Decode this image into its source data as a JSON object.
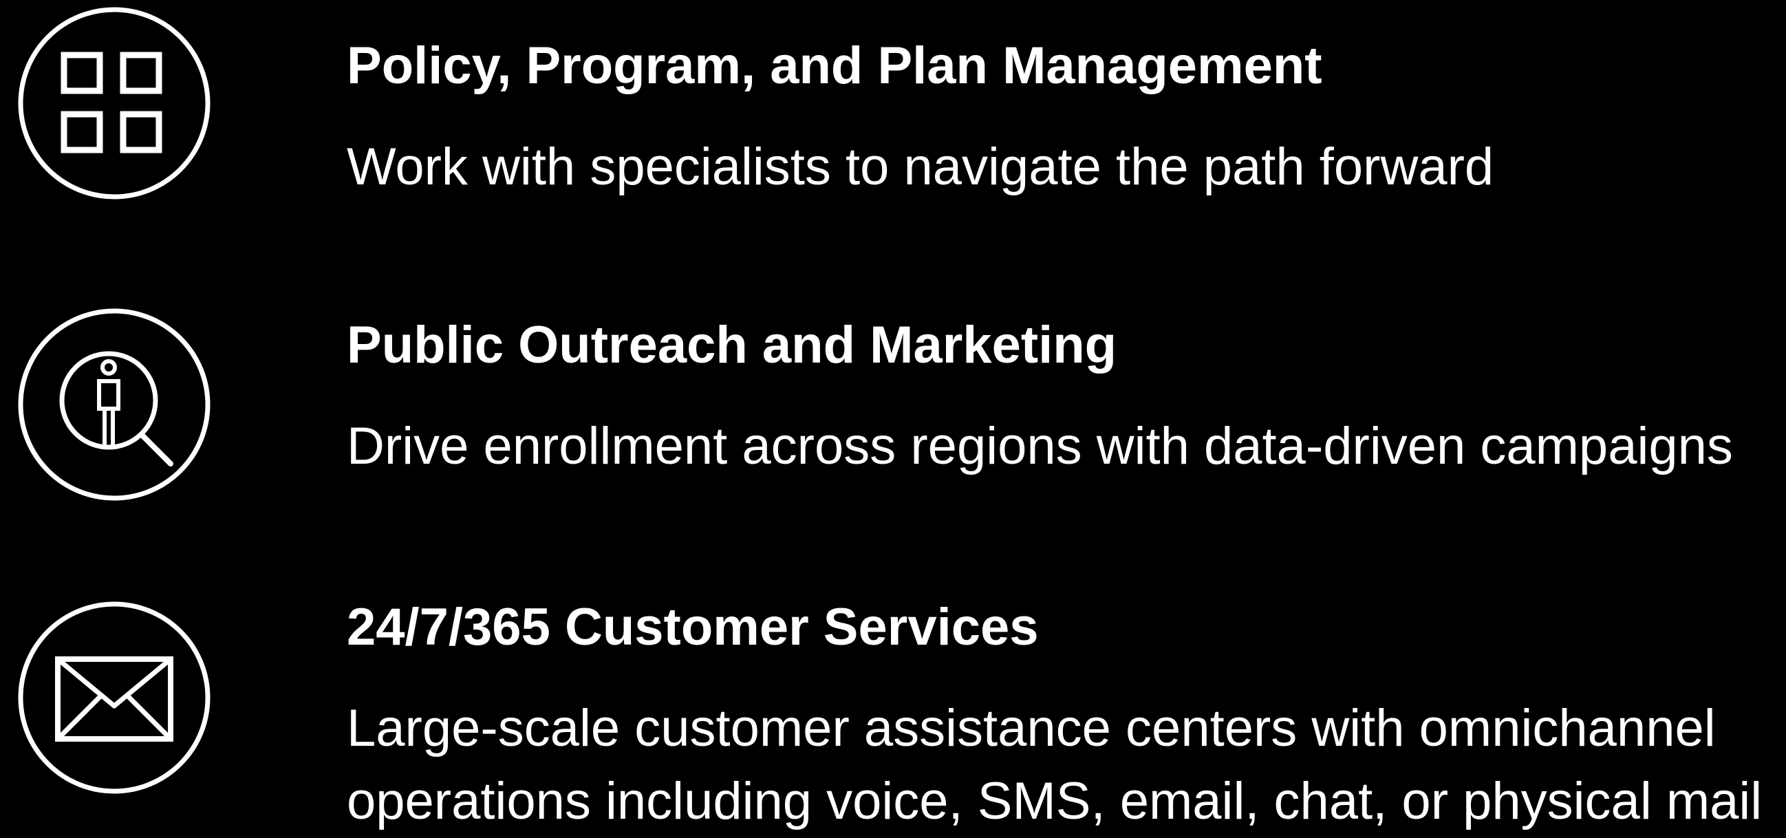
{
  "services": [
    {
      "icon": "grid-icon",
      "title": "Policy, Program, and Plan Management",
      "description": "Work with specialists to navigate the path forward"
    },
    {
      "icon": "person-magnifier-icon",
      "title": "Public Outreach and Marketing",
      "description": "Drive enrollment across regions with data-driven campaigns"
    },
    {
      "icon": "envelope-icon",
      "title": "24/7/365 Customer Services",
      "description_lines": [
        "Large-scale customer assistance centers with omnichannel",
        "operations including voice, SMS, email, chat, or physical mail"
      ]
    }
  ],
  "colors": {
    "background": "#000000",
    "foreground": "#ffffff"
  }
}
